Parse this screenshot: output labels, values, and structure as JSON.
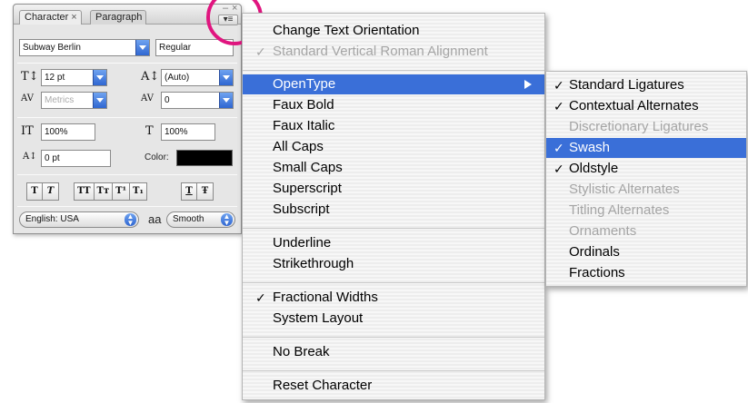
{
  "panel": {
    "tabs": [
      {
        "label": "Character",
        "close": "×"
      },
      {
        "label": "Paragraph"
      }
    ],
    "window_controls": {
      "minimize": "–",
      "close": "×"
    },
    "menu_button_glyph": "▾≡",
    "font_family": "Subway Berlin",
    "font_style": "Regular",
    "font_size": "12 pt",
    "leading": "(Auto)",
    "kerning": "Metrics",
    "tracking": "0",
    "vertical_scale": "100%",
    "horizontal_scale": "100%",
    "baseline_shift": "0 pt",
    "color_label": "Color:",
    "color_value": "#000000",
    "style_buttons": [
      "T",
      "T",
      "TT",
      "Tт",
      "T¹",
      "T₁",
      "T",
      "Ŧ"
    ],
    "language": "English: USA",
    "antialias_icon": "aa",
    "antialias": "Smooth",
    "icons": {
      "size": "T↕",
      "leading": "A↕",
      "kerning": "AV",
      "tracking": "AV",
      "vscale": "IT",
      "hscale": "T",
      "baseline": "A↕"
    }
  },
  "menu": {
    "items": [
      {
        "label": "Change Text Orientation",
        "checked": false,
        "disabled": false
      },
      {
        "label": "Standard Vertical Roman Alignment",
        "checked": true,
        "disabled": true
      },
      {
        "label": "OpenType",
        "checked": false,
        "disabled": false,
        "highlighted": true,
        "submenu": true
      },
      {
        "label": "Faux Bold",
        "checked": false,
        "disabled": false
      },
      {
        "label": "Faux Italic",
        "checked": false,
        "disabled": false
      },
      {
        "label": "All Caps",
        "checked": false,
        "disabled": false
      },
      {
        "label": "Small Caps",
        "checked": false,
        "disabled": false
      },
      {
        "label": "Superscript",
        "checked": false,
        "disabled": false
      },
      {
        "label": "Subscript",
        "checked": false,
        "disabled": false
      },
      {
        "label": "Underline",
        "checked": false,
        "disabled": false
      },
      {
        "label": "Strikethrough",
        "checked": false,
        "disabled": false
      },
      {
        "label": "Fractional Widths",
        "checked": true,
        "disabled": false
      },
      {
        "label": "System Layout",
        "checked": false,
        "disabled": false
      },
      {
        "label": "No Break",
        "checked": false,
        "disabled": false
      },
      {
        "label": "Reset Character",
        "checked": false,
        "disabled": false
      }
    ],
    "checkmark": "✓"
  },
  "submenu": {
    "items": [
      {
        "label": "Standard Ligatures",
        "checked": true,
        "disabled": false
      },
      {
        "label": "Contextual Alternates",
        "checked": true,
        "disabled": false
      },
      {
        "label": "Discretionary Ligatures",
        "checked": false,
        "disabled": true
      },
      {
        "label": "Swash",
        "checked": true,
        "disabled": false,
        "highlighted": true
      },
      {
        "label": "Oldstyle",
        "checked": true,
        "disabled": false
      },
      {
        "label": "Stylistic Alternates",
        "checked": false,
        "disabled": true
      },
      {
        "label": "Titling Alternates",
        "checked": false,
        "disabled": true
      },
      {
        "label": "Ornaments",
        "checked": false,
        "disabled": true
      },
      {
        "label": "Ordinals",
        "checked": false,
        "disabled": false
      },
      {
        "label": "Fractions",
        "checked": false,
        "disabled": false
      }
    ]
  },
  "colors": {
    "highlight": "#3a6fd8",
    "annotation_ring": "#e0157f",
    "disabled_text": "#a5a5a5"
  }
}
